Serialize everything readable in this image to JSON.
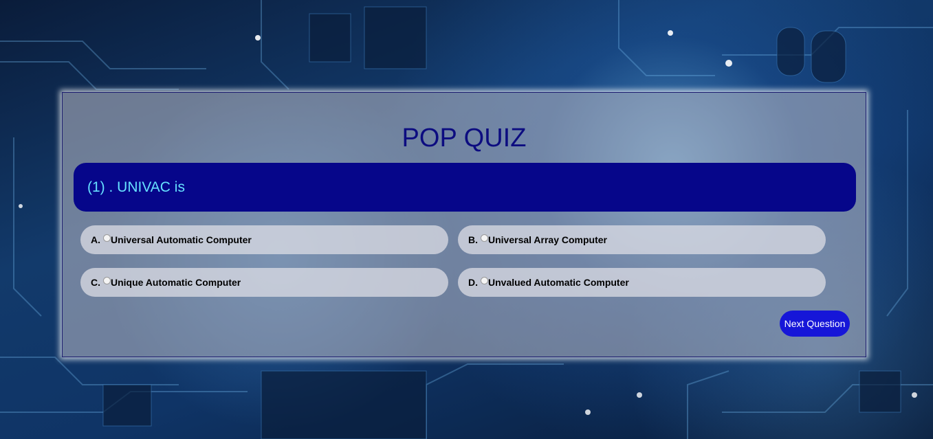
{
  "quiz": {
    "title": "POP QUIZ",
    "question": "(1) . UNIVAC is",
    "options": [
      {
        "letter": "A.",
        "text": "Universal Automatic Computer"
      },
      {
        "letter": "B.",
        "text": "Universal Array Computer"
      },
      {
        "letter": "C.",
        "text": "Unique Automatic Computer"
      },
      {
        "letter": "D.",
        "text": "Unvalued Automatic Computer"
      }
    ],
    "next_label": "Next Question"
  },
  "colors": {
    "panel_border": "#1a1a6e",
    "title": "#0c0c80",
    "question_bg": "#06068a",
    "question_text": "#66e0ff",
    "next_button": "#1616d8"
  }
}
